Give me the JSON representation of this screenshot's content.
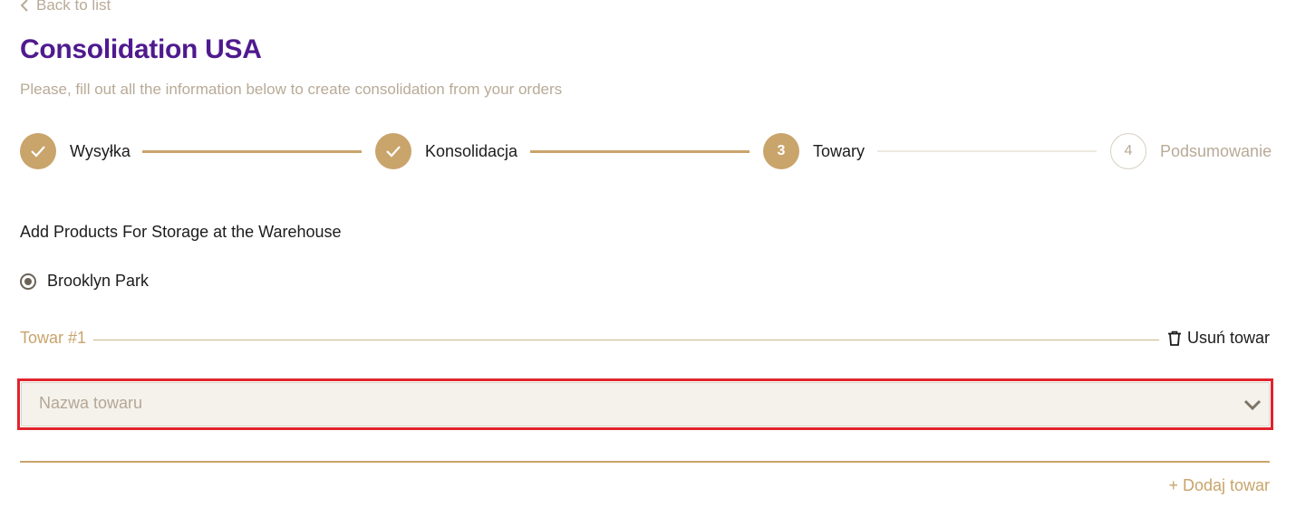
{
  "nav": {
    "back_label": "Back to list"
  },
  "header": {
    "title": "Consolidation USA",
    "subtitle": "Please, fill out all the information below to create consolidation from your orders"
  },
  "stepper": {
    "steps": [
      {
        "label": "Wysyłka",
        "number": "1",
        "state": "done"
      },
      {
        "label": "Konsolidacja",
        "number": "2",
        "state": "done"
      },
      {
        "label": "Towary",
        "number": "3",
        "state": "active"
      },
      {
        "label": "Podsumowanie",
        "number": "4",
        "state": "todo"
      }
    ]
  },
  "storage": {
    "title": "Add Products For Storage at the Warehouse",
    "warehouse_option": "Brooklyn Park",
    "warehouse_selected": true
  },
  "item": {
    "title": "Towar #1",
    "remove_label": "Usuń towar",
    "name_placeholder": "Nazwa towaru"
  },
  "actions": {
    "add_label": "+ Dodaj towar"
  },
  "colors": {
    "brand_purple": "#4f1a8e",
    "accent_gold": "#c9a46b",
    "muted_text": "#b8aa97",
    "highlight_red": "#e0242c"
  }
}
